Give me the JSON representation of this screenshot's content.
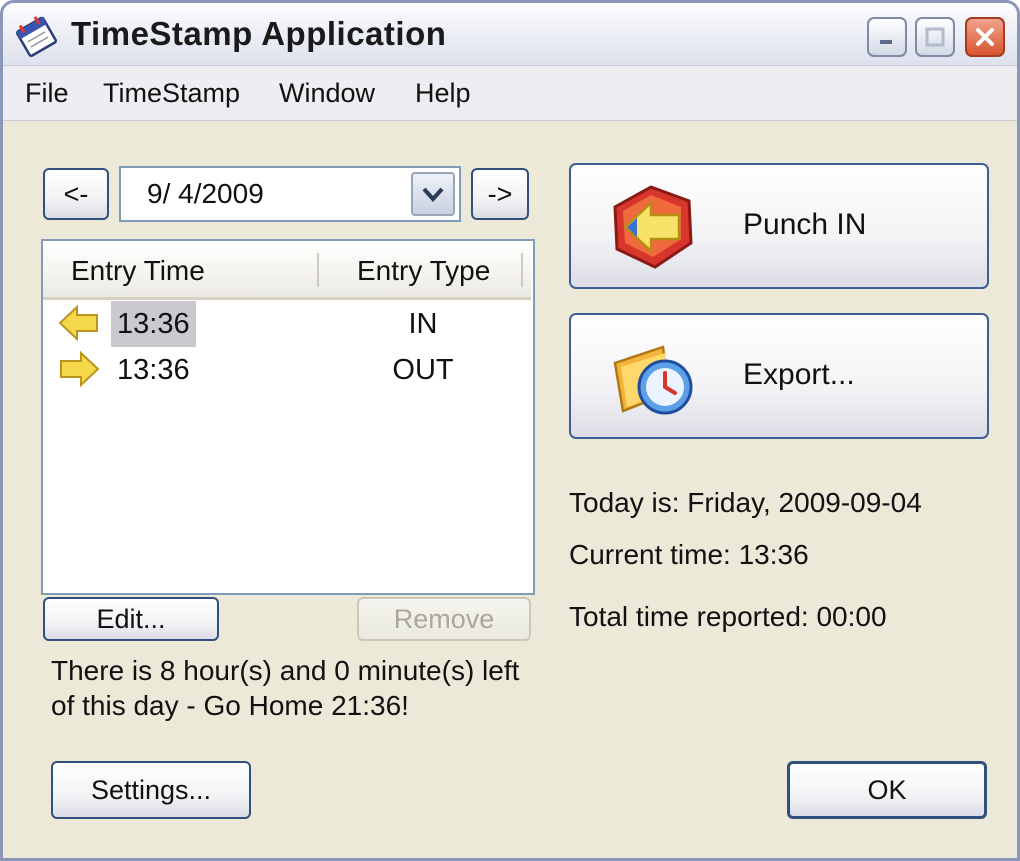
{
  "window": {
    "title": "TimeStamp Application"
  },
  "menu": [
    "File",
    "TimeStamp",
    "Window",
    "Help"
  ],
  "date_nav": {
    "prev_label": "<-",
    "next_label": "->",
    "date_value": "9/  4/2009"
  },
  "entries": {
    "columns": [
      "Entry Time",
      "Entry Type"
    ],
    "rows": [
      {
        "time": "13:36",
        "type": "IN",
        "icon": "arrow-left-icon",
        "selected": true
      },
      {
        "time": "13:36",
        "type": "OUT",
        "icon": "arrow-right-icon",
        "selected": false
      }
    ]
  },
  "actions": {
    "edit_label": "Edit...",
    "remove_label": "Remove",
    "remove_enabled": false
  },
  "remaining_text_line1": "There is 8 hour(s) and 0 minute(s) left",
  "remaining_text_line2": "of this day - Go Home 21:36!",
  "punch_button": {
    "label": "Punch IN",
    "icon": "punch-icon"
  },
  "export_button": {
    "label": "Export...",
    "icon": "export-clock-icon"
  },
  "status": {
    "today": "Today is: Friday, 2009-09-04",
    "current_time": "Current time: 13:36",
    "total_reported": "Total time reported: 00:00"
  },
  "footer": {
    "settings_label": "Settings...",
    "ok_label": "OK"
  },
  "colors": {
    "window_bg": "#ece9d8",
    "button_border": "#32507e",
    "selection": "#c9c9cf",
    "arrow_yellow": "#f5d84a"
  }
}
